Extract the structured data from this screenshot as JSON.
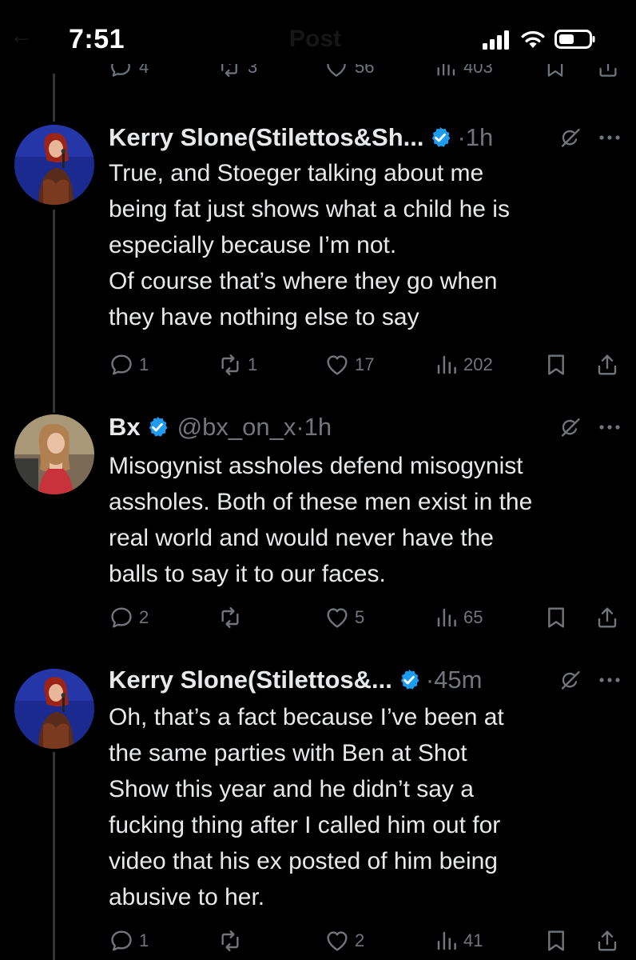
{
  "status_bar": {
    "time": "7:51",
    "header_ghost": "Post"
  },
  "ghost_row": {
    "replies": "4",
    "reposts": "3",
    "likes": "56",
    "views": "403"
  },
  "tweets": [
    {
      "display_name": "Kerry Slone(Stilettos&Sh...",
      "handle": "",
      "time": "·1h",
      "lines": [
        "True, and Stoeger talking about me",
        "being fat just shows what a child he is",
        "especially because I’m not.",
        "Of course that’s where they go when",
        "they have nothing else to say"
      ],
      "replies": "1",
      "reposts": "1",
      "likes": "17",
      "views": "202"
    },
    {
      "display_name": "Bx",
      "handle": "@bx_on_x",
      "time": "·1h",
      "lines": [
        "Misogynist assholes defend misogynist",
        "assholes. Both of these men exist in the",
        "real world and would never have the",
        "balls to say it to our faces."
      ],
      "replies": "2",
      "reposts": "",
      "likes": "5",
      "views": "65"
    },
    {
      "display_name": "Kerry Slone(Stilettos&...",
      "handle": "",
      "time": "·45m",
      "lines": [
        "Oh, that’s a fact because I’ve been at",
        "the same parties with Ben at Shot",
        "Show this year and he didn’t say a",
        "fucking thing after I called him out for",
        "video that his ex posted of him being",
        "abusive to her."
      ],
      "replies": "1",
      "reposts": "",
      "likes": "2",
      "views": "41"
    }
  ],
  "colors": {
    "background": "#000000",
    "text": "#e7e9ea",
    "muted": "#71767b",
    "verified": "#1d9bf0",
    "thread_line": "#333639"
  },
  "icons": {
    "reply": "reply-icon",
    "repost": "repost-icon",
    "like": "heart-icon",
    "views": "views-icon",
    "bookmark": "bookmark-icon",
    "share": "share-icon",
    "verified": "verified-badge-icon",
    "grok": "grok-icon",
    "more": "more-icon"
  }
}
